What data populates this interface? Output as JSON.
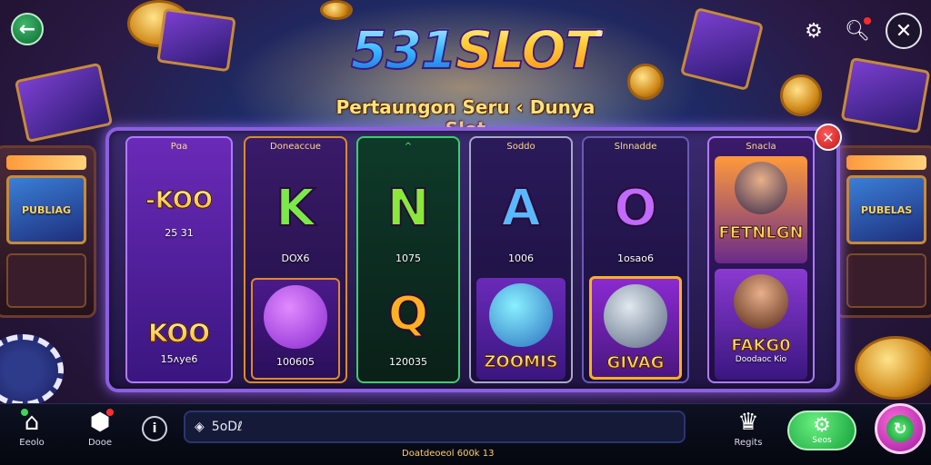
{
  "theme": {
    "accent_purple": "#8b5fe0",
    "accent_gold": "#ffcc33",
    "accent_green": "#22b04a",
    "close_red": "#d82020"
  },
  "header": {
    "logo_digits": "531",
    "logo_word": "SLOT",
    "logo_registered": "®",
    "tagline": "Pertaungon Seru ‹ Dunya Slot",
    "back_icon": "arrow-left-icon",
    "settings_icon": "gear-icon",
    "search_icon": "search-icon",
    "close_icon": "close-icon"
  },
  "reels": [
    {
      "header": "Pɑa",
      "top": {
        "symbol": "-KOO",
        "caption": "25 31",
        "style": "text"
      },
      "bottom": {
        "symbol": "KOO",
        "caption": "15ʌye6",
        "style": "text"
      }
    },
    {
      "header": "Doneaccue",
      "top": {
        "symbol": "K",
        "caption": "DOX6",
        "style": "letter"
      },
      "bottom": {
        "symbol": "",
        "caption": "100605",
        "style": "item"
      }
    },
    {
      "header": "^",
      "top": {
        "symbol": "N",
        "caption": "1075",
        "style": "letter"
      },
      "bottom": {
        "symbol": "Q",
        "caption": "120035",
        "style": "letter"
      }
    },
    {
      "header": "Soddo",
      "top": {
        "symbol": "A",
        "caption": "1006",
        "style": "letter"
      },
      "bottom": {
        "symbol": "ZOOMIS",
        "caption": "",
        "style": "text"
      }
    },
    {
      "header": "Slnnadde",
      "top": {
        "symbol": "O",
        "caption": "1osao6",
        "style": "letter"
      },
      "bottom": {
        "symbol": "GIVAG",
        "caption": "",
        "style": "text"
      }
    },
    {
      "header": "Snacla",
      "top": {
        "symbol": "FETNLGN",
        "caption": "",
        "style": "text"
      },
      "bottom": {
        "symbol": "FAKG0",
        "caption": "Doodaoc Kio",
        "style": "text"
      }
    }
  ],
  "bottom_bar": {
    "home_label": "Eeolo",
    "home_icon": "home-icon",
    "shop_label": "Dooe",
    "shop_icon": "gift-icon",
    "info_icon": "info-icon",
    "search_value": "5oDℓ",
    "search_icon": "diamond-icon",
    "footnote": "Doatdeoeol 600k 13",
    "rewards_label": "Regits",
    "rewards_icon": "trophy-icon",
    "settings_label": "Seos",
    "settings_icon": "gear-icon",
    "spin_icon": "spin-icon"
  }
}
